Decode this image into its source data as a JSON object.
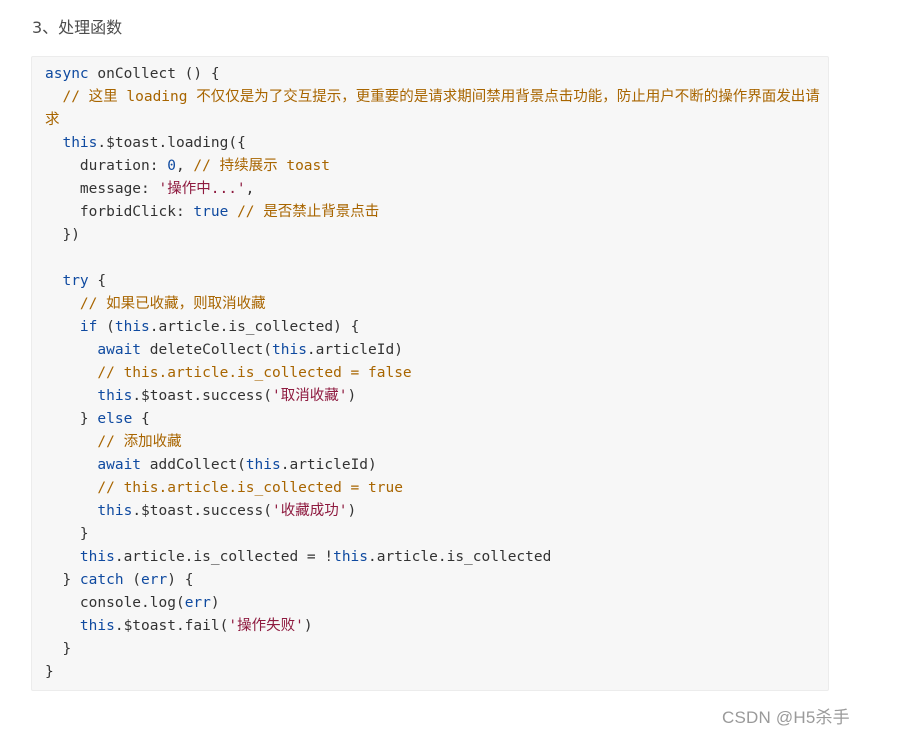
{
  "heading": "3、处理函数",
  "code": {
    "l01_a": "async",
    "l01_b": " onCollect () {",
    "l02": "  // 这里 loading 不仅仅是为了交互提示，更重要的是请求期间禁用背景点击功能，防止用户不断的操作界面发出请求",
    "l03_a": "  ",
    "l03_b": "this",
    "l03_c": ".$toast.loading({",
    "l04_a": "    duration: ",
    "l04_b": "0",
    "l04_c": ", ",
    "l04_d": "// 持续展示 toast",
    "l05_a": "    message: ",
    "l05_b": "'操作中...'",
    "l05_c": ",",
    "l06_a": "    forbidClick: ",
    "l06_b": "true",
    "l06_c": " ",
    "l06_d": "// 是否禁止背景点击",
    "l07": "  })",
    "l08": "",
    "l09_a": "  ",
    "l09_b": "try",
    "l09_c": " {",
    "l10": "    // 如果已收藏，则取消收藏",
    "l11_a": "    ",
    "l11_b": "if",
    "l11_c": " (",
    "l11_d": "this",
    "l11_e": ".article.is_collected) {",
    "l12_a": "      ",
    "l12_b": "await",
    "l12_c": " deleteCollect(",
    "l12_d": "this",
    "l12_e": ".articleId)",
    "l13": "      // this.article.is_collected = false",
    "l14_a": "      ",
    "l14_b": "this",
    "l14_c": ".$toast.success(",
    "l14_d": "'取消收藏'",
    "l14_e": ")",
    "l15_a": "    } ",
    "l15_b": "else",
    "l15_c": " {",
    "l16": "      // 添加收藏",
    "l17_a": "      ",
    "l17_b": "await",
    "l17_c": " addCollect(",
    "l17_d": "this",
    "l17_e": ".articleId)",
    "l18": "      // this.article.is_collected = true",
    "l19_a": "      ",
    "l19_b": "this",
    "l19_c": ".$toast.success(",
    "l19_d": "'收藏成功'",
    "l19_e": ")",
    "l20": "    }",
    "l21_a": "    ",
    "l21_b": "this",
    "l21_c": ".article.is_collected = !",
    "l21_d": "this",
    "l21_e": ".article.is_collected",
    "l22_a": "  } ",
    "l22_b": "catch",
    "l22_c": " (",
    "l22_d": "err",
    "l22_e": ") {",
    "l23_a": "    console.log(",
    "l23_b": "err",
    "l23_c": ")",
    "l24_a": "    ",
    "l24_b": "this",
    "l24_c": ".$toast.fail(",
    "l24_d": "'操作失败'",
    "l24_e": ")",
    "l25": "  }",
    "l26": "}"
  },
  "watermark": "CSDN @H5杀手"
}
